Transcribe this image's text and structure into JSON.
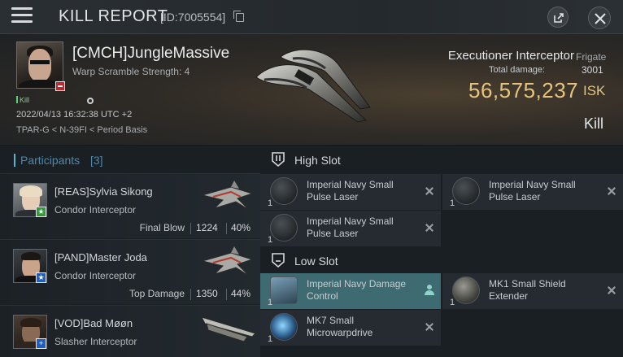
{
  "header": {
    "title": "KILL REPORT",
    "id_text": "[ID:7005554]"
  },
  "victim": {
    "name": "[CMCH]JungleMassive",
    "warp_scramble": "Warp Scramble Strength: 4",
    "kill_tag": "Kill",
    "time": "2022/04/13 16:32:38 UTC +2",
    "location": "TPAR-G < N-39FI < Period Basis",
    "ship_name": "Executioner Interceptor",
    "ship_class": "Frigate",
    "total_damage_label": "Total damage:",
    "total_damage": "3001",
    "isk_value": "56,575,237",
    "isk_unit": "ISK",
    "result": "Kill"
  },
  "participants": {
    "label": "Participants",
    "count": "[3]",
    "rows": [
      {
        "name": "[REAS]Sylvia Sikong",
        "ship": "Condor Interceptor",
        "role": "Final Blow",
        "damage": "1224",
        "percent": "40%",
        "badge": "★",
        "badge_color": "#2e9a3c"
      },
      {
        "name": "[PAND]Master Joda",
        "ship": "Condor Interceptor",
        "role": "Top Damage",
        "damage": "1350",
        "percent": "44%",
        "badge": "★",
        "badge_color": "#1f5fc2"
      },
      {
        "name": "[VOD]Bad Møøn",
        "ship": "Slasher Interceptor",
        "role": "",
        "damage": "",
        "percent": "",
        "badge": "+",
        "badge_color": "#1f5fc2"
      }
    ]
  },
  "fitting": {
    "high_slot_title": "High Slot",
    "low_slot_title": "Low Slot",
    "high": [
      {
        "name": "Imperial Navy Small Pulse Laser",
        "qty": "1"
      },
      {
        "name": "Imperial Navy Small Pulse Laser",
        "qty": "1"
      },
      {
        "name": "Imperial Navy Small Pulse Laser",
        "qty": "1"
      }
    ],
    "low": [
      {
        "name": "Imperial Navy Damage Control",
        "qty": "1"
      },
      {
        "name": "MK1 Small Shield Extender",
        "qty": "1"
      },
      {
        "name": "MK7 Small Microwarpdrive",
        "qty": "1"
      }
    ]
  },
  "colors": {
    "isk": "#e7c37d",
    "accent_blue": "#4f88ab",
    "active_module": "#3e6b71"
  }
}
